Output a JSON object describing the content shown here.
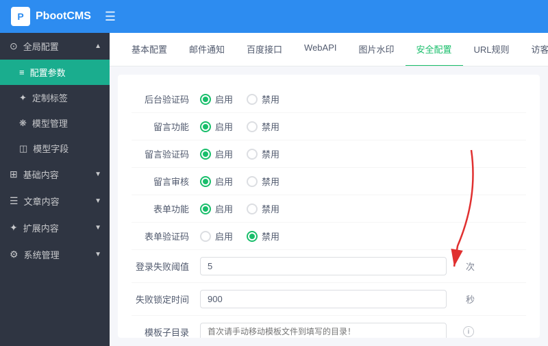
{
  "header": {
    "logo_text": "PbootCMS",
    "logo_icon": "P",
    "menu_icon": "☰"
  },
  "sidebar": {
    "groups": [
      {
        "id": "global-config",
        "icon": "⊙",
        "label": "全局配置",
        "arrow": "▲",
        "items": [
          {
            "id": "config-params",
            "icon": "≡",
            "label": "配置参数",
            "active": true
          },
          {
            "id": "custom-tags",
            "icon": "✦",
            "label": "定制标签",
            "active": false
          },
          {
            "id": "template-manage",
            "icon": "❋",
            "label": "模型管理",
            "active": false
          },
          {
            "id": "template-fields",
            "icon": "◫",
            "label": "模型字段",
            "active": false
          }
        ]
      },
      {
        "id": "basic-content",
        "icon": "⊞",
        "label": "基础内容",
        "arrow": "▼",
        "items": []
      },
      {
        "id": "article-content",
        "icon": "☰",
        "label": "文章内容",
        "arrow": "▼",
        "items": []
      },
      {
        "id": "extend-content",
        "icon": "✦",
        "label": "扩展内容",
        "arrow": "▼",
        "items": []
      },
      {
        "id": "system-manage",
        "icon": "⚙",
        "label": "系统管理",
        "arrow": "▼",
        "items": []
      }
    ]
  },
  "tabs": [
    {
      "id": "basic",
      "label": "基本配置",
      "active": false
    },
    {
      "id": "email",
      "label": "邮件通知",
      "active": false
    },
    {
      "id": "baidu",
      "label": "百度接口",
      "active": false
    },
    {
      "id": "webapi",
      "label": "WebAPI",
      "active": false
    },
    {
      "id": "watermark",
      "label": "图片水印",
      "active": false
    },
    {
      "id": "security",
      "label": "安全配置",
      "active": true
    },
    {
      "id": "url",
      "label": "URL规则",
      "active": false
    },
    {
      "id": "visitor",
      "label": "访客信息",
      "active": false
    }
  ],
  "form": {
    "rows": [
      {
        "id": "backend-captcha",
        "label": "后台验证码",
        "type": "radio",
        "options": [
          {
            "label": "启用",
            "checked": true
          },
          {
            "label": "禁用",
            "checked": false
          }
        ]
      },
      {
        "id": "comment-function",
        "label": "留言功能",
        "type": "radio",
        "options": [
          {
            "label": "启用",
            "checked": true
          },
          {
            "label": "禁用",
            "checked": false
          }
        ]
      },
      {
        "id": "comment-captcha",
        "label": "留言验证码",
        "type": "radio",
        "options": [
          {
            "label": "启用",
            "checked": true
          },
          {
            "label": "禁用",
            "checked": false
          }
        ]
      },
      {
        "id": "comment-audit",
        "label": "留言审核",
        "type": "radio",
        "options": [
          {
            "label": "启用",
            "checked": true
          },
          {
            "label": "禁用",
            "checked": false
          }
        ]
      },
      {
        "id": "form-function",
        "label": "表单功能",
        "type": "radio",
        "options": [
          {
            "label": "启用",
            "checked": true
          },
          {
            "label": "禁用",
            "checked": false
          }
        ]
      },
      {
        "id": "form-captcha",
        "label": "表单验证码",
        "type": "radio",
        "options": [
          {
            "label": "启用",
            "checked": false
          },
          {
            "label": "禁用",
            "checked": true
          }
        ]
      },
      {
        "id": "login-fail-threshold",
        "label": "登录失败阈值",
        "type": "input",
        "value": "5",
        "unit": "次"
      },
      {
        "id": "lock-time",
        "label": "失败锁定时间",
        "type": "input",
        "value": "900",
        "unit": "秒"
      },
      {
        "id": "template-dir",
        "label": "模板子目录",
        "type": "input",
        "value": "",
        "placeholder": "首次请手动移动模板文件到填写的目录！",
        "has_info": true
      }
    ]
  },
  "annotation": {
    "arrow_color": "#e03030"
  }
}
